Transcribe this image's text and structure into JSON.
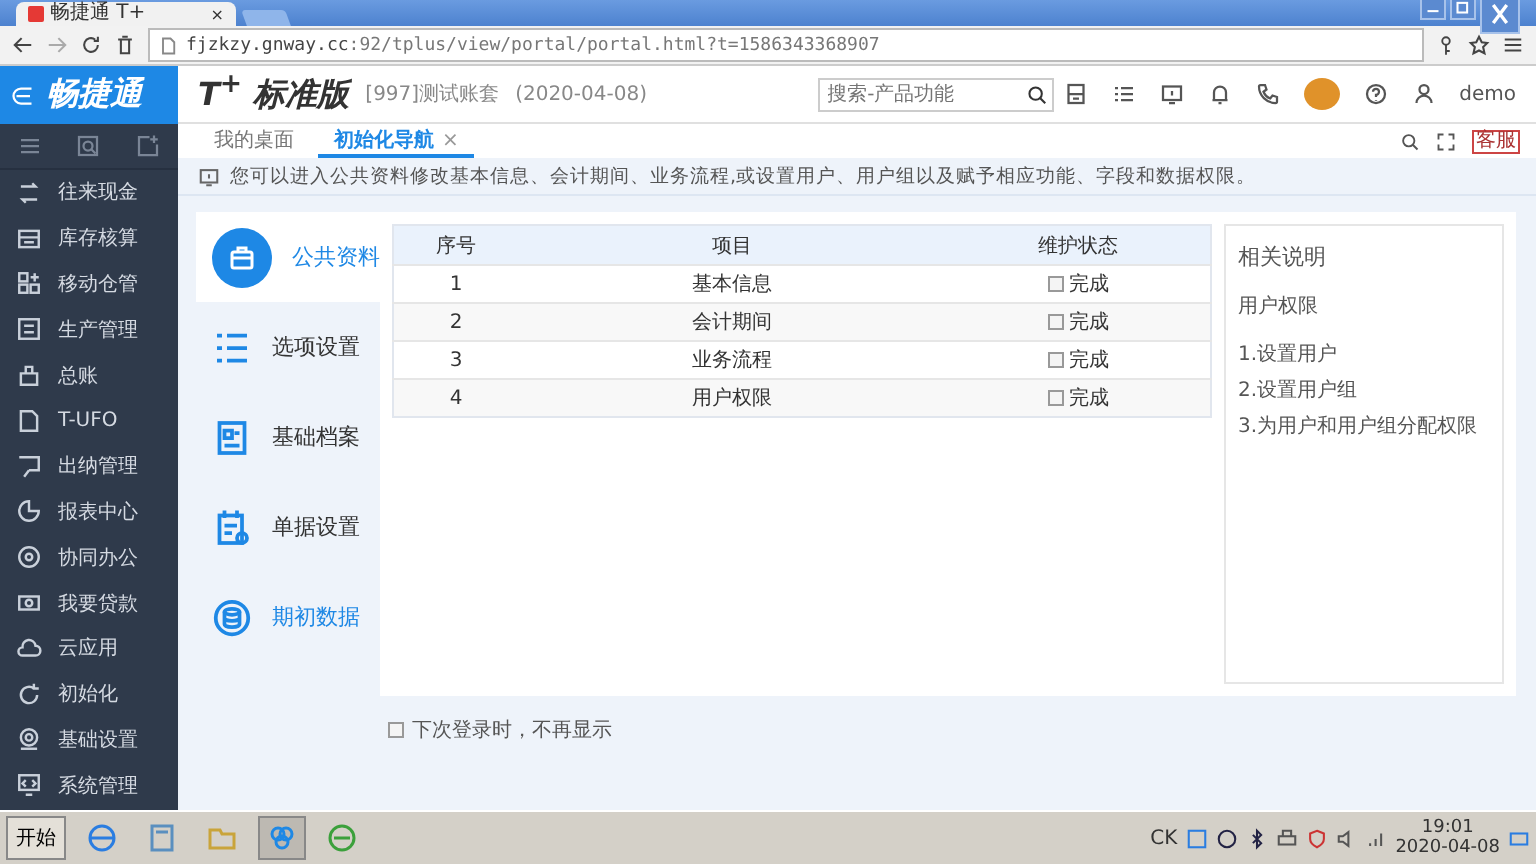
{
  "browser": {
    "tab_title": "畅捷通 T+",
    "tab_close": "×",
    "url_host": "fjzkzy.gnway.cc",
    "url_path": ":92/tplus/view/portal/portal.html?t=1586343368907"
  },
  "brand": {
    "name": "畅捷通"
  },
  "header": {
    "product": "T$^{+}$ 标准版",
    "account": "[997]测试账套",
    "date": "(2020-04-08)",
    "search": {
      "placeholder": "搜索-产品功能"
    },
    "user": "demo",
    "support_badge": "客服"
  },
  "sidebar": {
    "items": [
      {
        "label": "往来现金"
      },
      {
        "label": "库存核算"
      },
      {
        "label": "移动仓管"
      },
      {
        "label": "生产管理"
      },
      {
        "label": "总账"
      },
      {
        "label": "T-UFO"
      },
      {
        "label": "出纳管理"
      },
      {
        "label": "报表中心"
      },
      {
        "label": "协同办公"
      },
      {
        "label": "我要贷款"
      },
      {
        "label": "云应用"
      },
      {
        "label": "初始化"
      },
      {
        "label": "基础设置"
      },
      {
        "label": "系统管理"
      }
    ]
  },
  "tabs": [
    {
      "label": "我的桌面",
      "selected": false
    },
    {
      "label": "初始化导航",
      "selected": true,
      "close": "×"
    }
  ],
  "info": "您可以进入公共资料修改基本信息、会计期间、业务流程,或设置用户、用户组以及赋予相应功能、字段和数据权限。",
  "nav": [
    {
      "label": "公共资料",
      "selected": true,
      "highlighted": false
    },
    {
      "label": "选项设置",
      "selected": false,
      "highlighted": false
    },
    {
      "label": "基础档案",
      "selected": false,
      "highlighted": false
    },
    {
      "label": "单据设置",
      "selected": false,
      "highlighted": false
    },
    {
      "label": "期初数据",
      "selected": false,
      "highlighted": true
    }
  ],
  "table": {
    "columns": [
      "序号",
      "项目",
      "维护状态"
    ],
    "rows": [
      {
        "no": "1",
        "item": "基本信息",
        "checked": false,
        "status": "完成"
      },
      {
        "no": "2",
        "item": "会计期间",
        "checked": false,
        "status": "完成"
      },
      {
        "no": "3",
        "item": "业务流程",
        "checked": false,
        "status": "完成"
      },
      {
        "no": "4",
        "item": "用户权限",
        "checked": false,
        "status": "完成"
      }
    ]
  },
  "help": {
    "title": "相关说明",
    "subtitle": "用户权限",
    "steps": [
      "1.设置用户",
      "2.设置用户组",
      "3.为用户和用户组分配权限"
    ]
  },
  "dont_show": {
    "label": "下次登录时，不再显示",
    "checked": false
  },
  "taskbar": {
    "start": "开始",
    "lang": "CK",
    "time": "19:01",
    "date": "2020-04-08"
  }
}
